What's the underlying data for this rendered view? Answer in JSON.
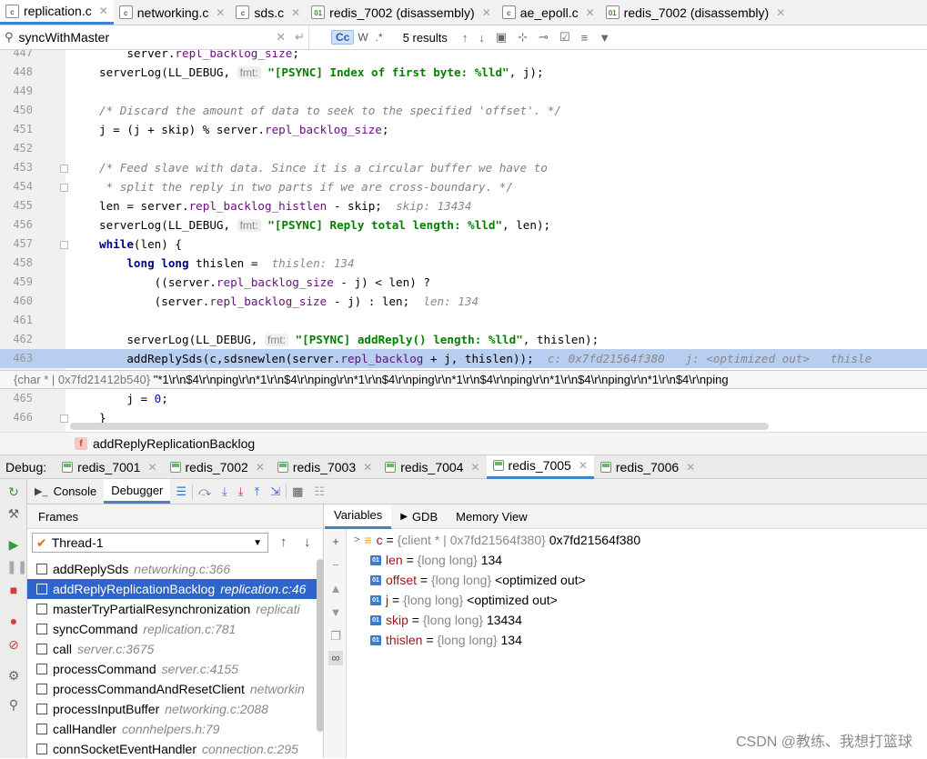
{
  "tabs": [
    {
      "label": "replication.c",
      "active": true,
      "icon": "c-file-icon"
    },
    {
      "label": "networking.c",
      "active": false,
      "icon": "c-file-icon"
    },
    {
      "label": "sds.c",
      "active": false,
      "icon": "c-file-icon"
    },
    {
      "label": "redis_7002 (disassembly)",
      "active": false,
      "icon": "disassembly-icon"
    },
    {
      "label": "ae_epoll.c",
      "active": false,
      "icon": "c-file-icon"
    },
    {
      "label": "redis_7002 (disassembly)",
      "active": false,
      "icon": "disassembly-icon"
    }
  ],
  "search": {
    "query": "syncWithMaster",
    "results": "5 results",
    "match_case": "Cc",
    "words": "W",
    "regex": ".*"
  },
  "editor": {
    "tooltip_type": "{char * | 0x7fd21412b540}",
    "tooltip_value": "\"*1\\r\\n$4\\r\\nping\\r\\n*1\\r\\n$4\\r\\nping\\r\\n*1\\r\\n$4\\r\\nping\\r\\n*1\\r\\n$4\\r\\nping\\r\\n*1\\r\\n$4\\r\\nping\\r\\n*1\\r\\n$4\\r\\nping"
  },
  "breadcrumb": {
    "function": "addReplyReplicationBacklog",
    "badge": "f"
  },
  "debug": {
    "label": "Debug:",
    "sessions": [
      "redis_7001",
      "redis_7002",
      "redis_7003",
      "redis_7004",
      "redis_7005",
      "redis_7006"
    ],
    "active_session": 4
  },
  "subtabs": {
    "console": "Console",
    "debugger": "Debugger"
  },
  "frames": {
    "header": "Frames",
    "thread": "Thread-1",
    "items": [
      {
        "name": "addReplySds",
        "loc": "networking.c:366"
      },
      {
        "name": "addReplyReplicationBacklog",
        "loc": "replication.c:46"
      },
      {
        "name": "masterTryPartialResynchronization",
        "loc": "replicati"
      },
      {
        "name": "syncCommand",
        "loc": "replication.c:781"
      },
      {
        "name": "call",
        "loc": "server.c:3675"
      },
      {
        "name": "processCommand",
        "loc": "server.c:4155"
      },
      {
        "name": "processCommandAndResetClient",
        "loc": "networkin"
      },
      {
        "name": "processInputBuffer",
        "loc": "networking.c:2088"
      },
      {
        "name": "callHandler",
        "loc": "connhelpers.h:79"
      },
      {
        "name": "connSocketEventHandler",
        "loc": "connection.c:295"
      }
    ],
    "selected": 1
  },
  "vars": {
    "tabs": [
      "Variables",
      "GDB",
      "Memory View"
    ],
    "items": [
      {
        "name": "c",
        "type": "{client * | 0x7fd21564f380}",
        "value": "0x7fd21564f380",
        "expandable": true,
        "badge": "≡"
      },
      {
        "name": "len",
        "type": "{long long}",
        "value": "134",
        "expandable": false,
        "badge": "01"
      },
      {
        "name": "offset",
        "type": "{long long}",
        "value": "<optimized out>",
        "expandable": false,
        "badge": "01"
      },
      {
        "name": "j",
        "type": "{long long}",
        "value": "<optimized out>",
        "expandable": false,
        "badge": "01"
      },
      {
        "name": "skip",
        "type": "{long long}",
        "value": "13434",
        "expandable": false,
        "badge": "01"
      },
      {
        "name": "thislen",
        "type": "{long long}",
        "value": "134",
        "expandable": false,
        "badge": "01"
      }
    ]
  },
  "watermark": "CSDN @教练、我想打篮球",
  "colors": {
    "accent": "#4083c9",
    "selection": "#2f65ca",
    "exec_line": "#b7cef0"
  }
}
